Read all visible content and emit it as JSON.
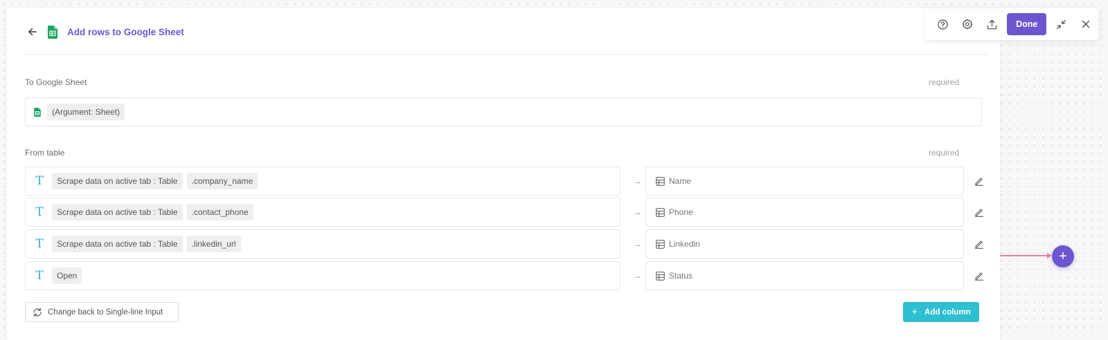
{
  "header": {
    "title": "Add rows to Google Sheet",
    "back_icon": "arrow-left-icon",
    "app_icon": "google-sheets-icon"
  },
  "toolbar": {
    "help_icon": "question-circle-icon",
    "settings_icon": "gear-icon",
    "export_icon": "upload-icon",
    "done_label": "Done",
    "collapse_icon": "minimize-icon",
    "close_icon": "close-icon"
  },
  "sheet_field": {
    "label": "To Google Sheet",
    "required": "required",
    "value": "(Argument: Sheet)"
  },
  "table_field": {
    "label": "From table",
    "required": "required",
    "rows": [
      {
        "source": "Scrape data on active tab : Table",
        "column_ref": ".company_name",
        "arrow": "→",
        "target": "Name"
      },
      {
        "source": "Scrape data on active tab : Table",
        "column_ref": ".contact_phone",
        "arrow": "→",
        "target": "Phone"
      },
      {
        "source": "Scrape data on active tab : Table",
        "column_ref": ".linkedin_url",
        "arrow": "→",
        "target": "Linkedin"
      },
      {
        "source": "Open",
        "arrow": "→",
        "target": "Status"
      }
    ]
  },
  "actions": {
    "change_label": "Change back to Single-line Input",
    "add_column_label": "Add column"
  },
  "colors": {
    "accent": "#6e55d0",
    "teal": "#2ebfd0",
    "sheets_green": "#1fa463",
    "connector": "#e7809a"
  }
}
